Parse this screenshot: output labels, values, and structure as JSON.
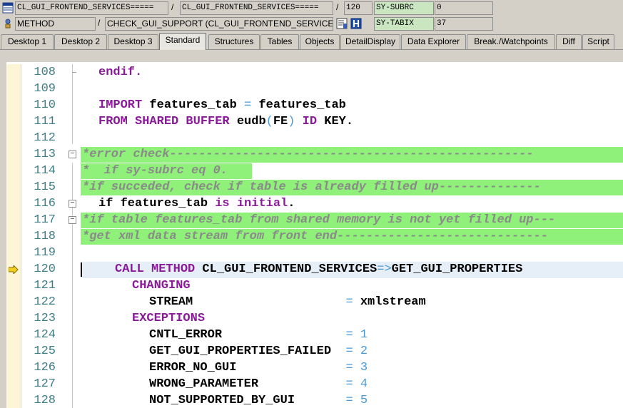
{
  "header": {
    "row1": {
      "program": "CL_GUI_FRONTEND_SERVICES=====",
      "include": "CL_GUI_FRONTEND_SERVICES=====",
      "line": "120",
      "sysfield1_name": "SY-SUBRC",
      "sysfield1_value": "0"
    },
    "row2": {
      "event_type": "METHOD",
      "event": "CHECK_GUI_SUPPORT (CL_GUI_FRONTEND_SERVICES)",
      "sysfield2_name": "SY-TABIX",
      "sysfield2_value": "37"
    },
    "separator": "/"
  },
  "tabs": [
    {
      "label": "Desktop 1"
    },
    {
      "label": "Desktop 2"
    },
    {
      "label": "Desktop 3"
    },
    {
      "label": "Standard",
      "active": true
    },
    {
      "label": "Structures"
    },
    {
      "label": "Tables"
    },
    {
      "label": "Objects"
    },
    {
      "label": "DetailDisplay"
    },
    {
      "label": "Data Explorer"
    },
    {
      "label": "Break./Watchpoints"
    },
    {
      "label": "Diff"
    },
    {
      "label": "Script"
    }
  ],
  "code_lines": [
    {
      "num": "108",
      "text": "endif."
    },
    {
      "num": "109",
      "text": ""
    },
    {
      "num": "110",
      "text": "IMPORT features_tab = features_tab"
    },
    {
      "num": "111",
      "text": "FROM SHARED BUFFER eudb(FE) ID KEY."
    },
    {
      "num": "112",
      "text": ""
    },
    {
      "num": "113",
      "text": "*error check--------------------------------------------------"
    },
    {
      "num": "114",
      "text": "*  if sy-subrc eq 0."
    },
    {
      "num": "115",
      "text": "*if succeded, check if table is already filled up--------------"
    },
    {
      "num": "116",
      "text": "if features_tab is initial."
    },
    {
      "num": "117",
      "text": "*if table features_tab from shared memory is not yet filled up---"
    },
    {
      "num": "118",
      "text": "*get xml data stream from front end-----------------------------"
    },
    {
      "num": "119",
      "text": ""
    },
    {
      "num": "120",
      "text": "CALL METHOD CL_GUI_FRONTEND_SERVICES=>GET_GUI_PROPERTIES"
    },
    {
      "num": "121",
      "text": "CHANGING"
    },
    {
      "num": "122",
      "text": "STREAM                     = xmlstream"
    },
    {
      "num": "123",
      "text": "EXCEPTIONS"
    },
    {
      "num": "124",
      "text": "CNTL_ERROR                 = 1"
    },
    {
      "num": "125",
      "text": "GET_GUI_PROPERTIES_FAILED  = 2"
    },
    {
      "num": "126",
      "text": "ERROR_NO_GUI               = 3"
    },
    {
      "num": "127",
      "text": "WRONG_PARAMETER            = 4"
    },
    {
      "num": "128",
      "text": "NOT_SUPPORTED_BY_GUI       = 5"
    }
  ],
  "current_line": "120",
  "colors": {
    "keyword": "#8b1a9a",
    "operator": "#4a9ad8",
    "comment_highlight": "#8ff07a",
    "line_number": "#3c7f86",
    "sysfield_bg": "#c9e6c0"
  },
  "icons": [
    "table-icon",
    "method-icon",
    "change-list-icon",
    "info-icon",
    "current-line-arrow-icon"
  ]
}
